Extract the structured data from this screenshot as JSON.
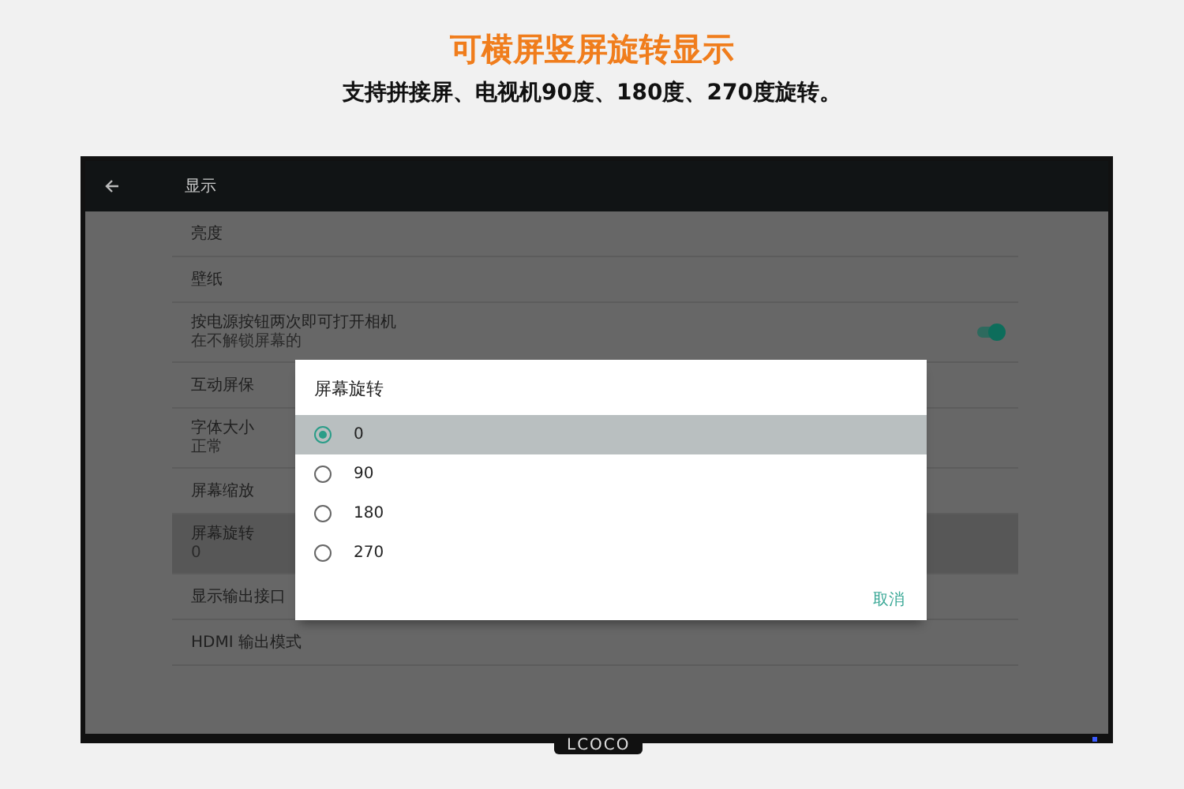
{
  "header": {
    "title": "可横屏竖屏旋转显示",
    "subtitle": "支持拼接屏、电视机90度、180度、270度旋转。"
  },
  "tv": {
    "brand": "LCOCO",
    "app_bar": {
      "title": "显示"
    },
    "settings": [
      {
        "kind": "plain",
        "label": "亮度",
        "selected": false
      },
      {
        "kind": "plain",
        "label": "壁纸",
        "selected": false
      },
      {
        "kind": "toggle",
        "label": "按电源按钮两次即可打开相机",
        "summary": "在不解锁屏幕的",
        "on": true,
        "selected": false
      },
      {
        "kind": "plain",
        "label": "互动屏保",
        "selected": false
      },
      {
        "kind": "plain",
        "label": "字体大小",
        "summary": "正常",
        "selected": false
      },
      {
        "kind": "plain",
        "label": "屏幕缩放",
        "selected": false
      },
      {
        "kind": "plain",
        "label": "屏幕旋转",
        "summary": "0",
        "selected": true
      },
      {
        "kind": "plain",
        "label": "显示输出接口",
        "selected": false
      },
      {
        "kind": "plain",
        "label": "HDMI 输出模式",
        "selected": false
      }
    ],
    "dialog": {
      "title": "屏幕旋转",
      "options": [
        {
          "label": "0",
          "selected": true
        },
        {
          "label": "90",
          "selected": false
        },
        {
          "label": "180",
          "selected": false
        },
        {
          "label": "270",
          "selected": false
        }
      ],
      "buttons": [
        "取消"
      ]
    }
  }
}
